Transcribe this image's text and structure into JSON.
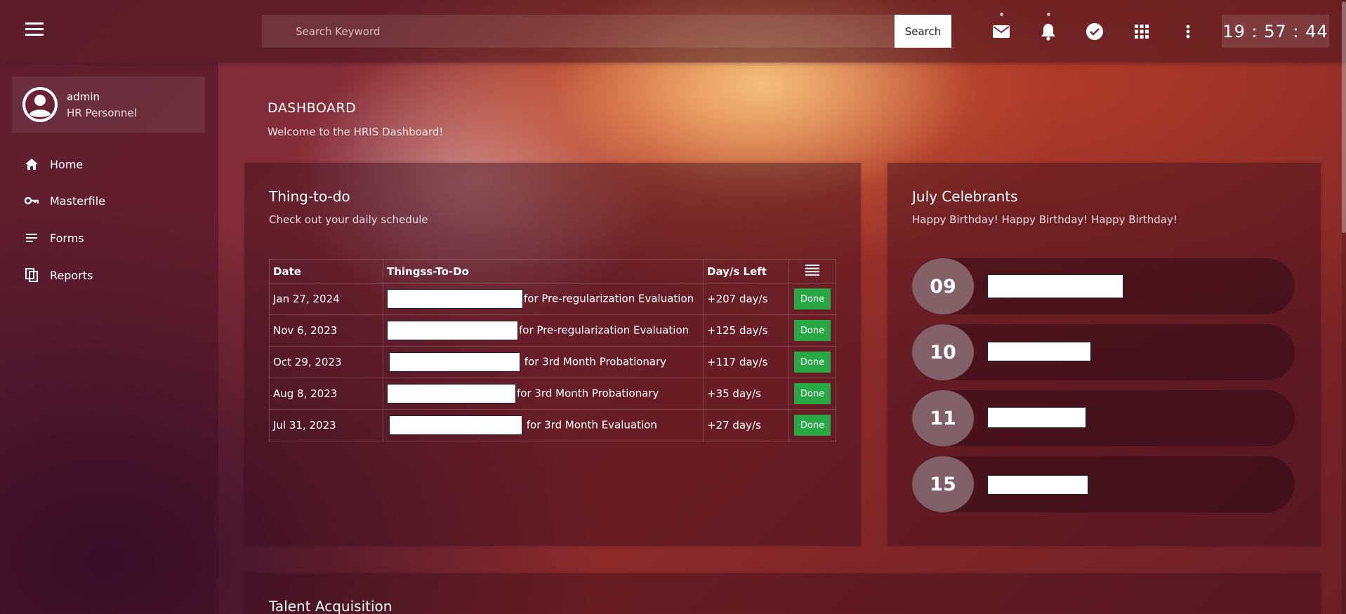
{
  "topbar": {
    "search": {
      "placeholder": "Search Keyword",
      "button_label": "Search"
    },
    "icons": [
      "menu-icon",
      "mail-icon",
      "bell-icon",
      "check-circle-icon",
      "apps-grid-icon",
      "more-vert-icon"
    ],
    "clock": "19 : 57 : 44"
  },
  "user": {
    "name": "admin",
    "role": "HR Personnel"
  },
  "sidebar": {
    "items": [
      {
        "label": "Home",
        "icon": "home-icon"
      },
      {
        "label": "Masterfile",
        "icon": "key-icon"
      },
      {
        "label": "Forms",
        "icon": "list-icon"
      },
      {
        "label": "Reports",
        "icon": "copy-icon"
      }
    ]
  },
  "page": {
    "title": "DASHBOARD",
    "subtitle": "Welcome to the HRIS Dashboard!"
  },
  "todo": {
    "title": "Thing-to-do",
    "subtitle": "Check out your daily schedule",
    "headers": {
      "date": "Date",
      "task": "Thingss-To-Do",
      "days_left": "Day/s Left"
    },
    "rows": [
      {
        "date": "Jan 27, 2024",
        "task": "for Pre-regularization Evaluation",
        "days_left": "+207 day/s",
        "action": "Done"
      },
      {
        "date": "Nov 6, 2023",
        "task": "for Pre-regularization Evaluation",
        "days_left": "+125 day/s",
        "action": "Done"
      },
      {
        "date": "Oct 29, 2023",
        "task": "for 3rd Month Probationary",
        "days_left": "+117 day/s",
        "action": "Done"
      },
      {
        "date": "Aug 8, 2023",
        "task": "for 3rd Month Probationary",
        "days_left": "+35 day/s",
        "action": "Done"
      },
      {
        "date": "Jul 31, 2023",
        "task": "for 3rd Month Evaluation",
        "days_left": "+27 day/s",
        "action": "Done"
      }
    ]
  },
  "celebrants": {
    "title": "July Celebrants",
    "subtitle": "Happy Birthday! Happy Birthday! Happy Birthday!",
    "items": [
      {
        "day": "09"
      },
      {
        "day": "10"
      },
      {
        "day": "11"
      },
      {
        "day": "15"
      }
    ]
  },
  "talent": {
    "title": "Talent Acquisition"
  },
  "colors": {
    "done_button": "#28a745",
    "accent_glow": "#f6c480"
  }
}
